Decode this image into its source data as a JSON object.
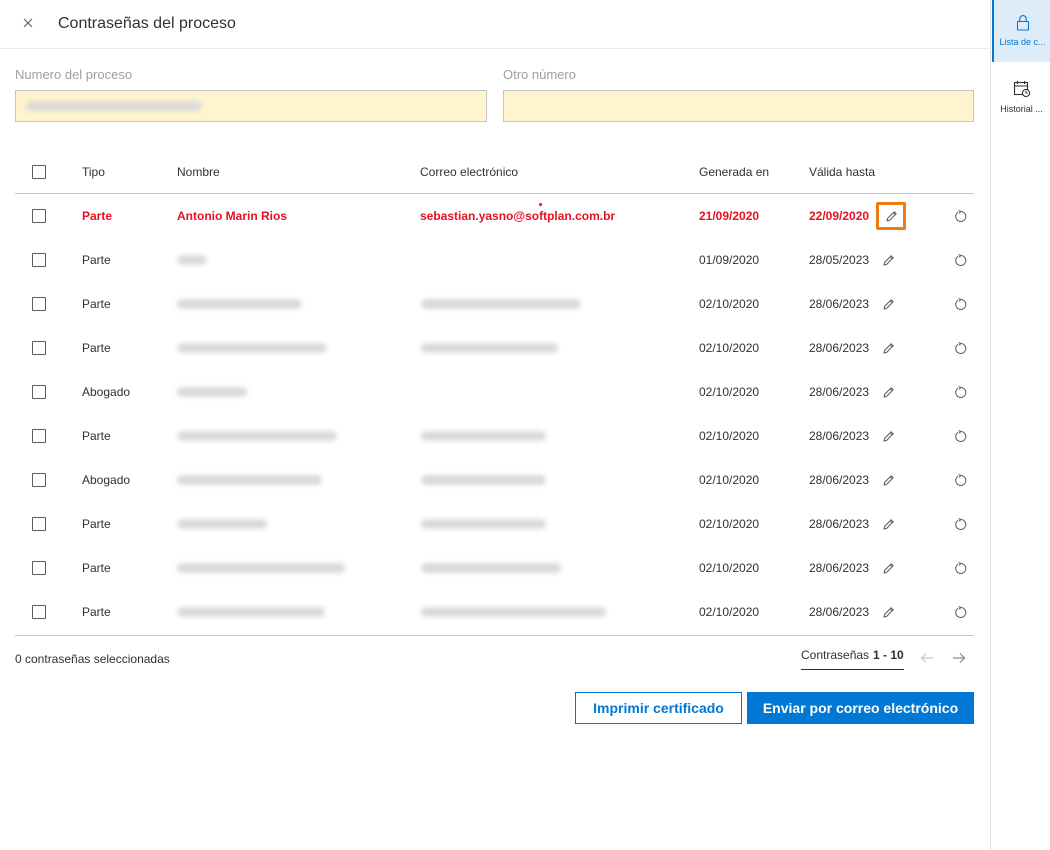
{
  "header": {
    "title": "Contraseñas del proceso",
    "close_icon": "close-icon"
  },
  "fields": {
    "process_number": {
      "label": "Numero del proceso"
    },
    "other_number": {
      "label": "Otro número"
    }
  },
  "table": {
    "headers": {
      "tipo": "Tipo",
      "nombre": "Nombre",
      "correo": "Correo electrónico",
      "generada": "Generada en",
      "valida": "Válida hasta"
    },
    "rows": [
      {
        "tipo": "Parte",
        "nombre": "Antonio Marin Rios",
        "correo": "sebastian.yasno@softplan.com.br",
        "generada": "21/09/2020",
        "valida": "22/09/2020"
      },
      {
        "tipo": "Parte",
        "nombre": "",
        "correo": "",
        "generada": "01/09/2020",
        "valida": "28/05/2023"
      },
      {
        "tipo": "Parte",
        "nombre": "",
        "correo": "",
        "generada": "02/10/2020",
        "valida": "28/06/2023"
      },
      {
        "tipo": "Parte",
        "nombre": "",
        "correo": "",
        "generada": "02/10/2020",
        "valida": "28/06/2023"
      },
      {
        "tipo": "Abogado",
        "nombre": "",
        "correo": "",
        "generada": "02/10/2020",
        "valida": "28/06/2023"
      },
      {
        "tipo": "Parte",
        "nombre": "",
        "correo": "",
        "generada": "02/10/2020",
        "valida": "28/06/2023"
      },
      {
        "tipo": "Abogado",
        "nombre": "",
        "correo": "",
        "generada": "02/10/2020",
        "valida": "28/06/2023"
      },
      {
        "tipo": "Parte",
        "nombre": "",
        "correo": "",
        "generada": "02/10/2020",
        "valida": "28/06/2023"
      },
      {
        "tipo": "Parte",
        "nombre": "",
        "correo": "",
        "generada": "02/10/2020",
        "valida": "28/06/2023"
      },
      {
        "tipo": "Parte",
        "nombre": "",
        "correo": "",
        "generada": "02/10/2020",
        "valida": "28/06/2023"
      }
    ]
  },
  "footer": {
    "selected_text": "0 contraseñas seleccionadas",
    "pager_label": "Contraseñas",
    "pager_range": "1 - 10"
  },
  "actions": {
    "print_label": "Imprimir certificado",
    "email_label": "Enviar por correo electrónico"
  },
  "rail": {
    "items": [
      {
        "label": "Lista de c...",
        "icon": "lock-icon",
        "active": true
      },
      {
        "label": "Historial ...",
        "icon": "calendar-clock-icon",
        "active": false
      }
    ]
  },
  "colors": {
    "accent": "#0078d4",
    "error": "#e81123",
    "input_fill": "#fff4ce",
    "focus_outline": "#ec7d12"
  }
}
